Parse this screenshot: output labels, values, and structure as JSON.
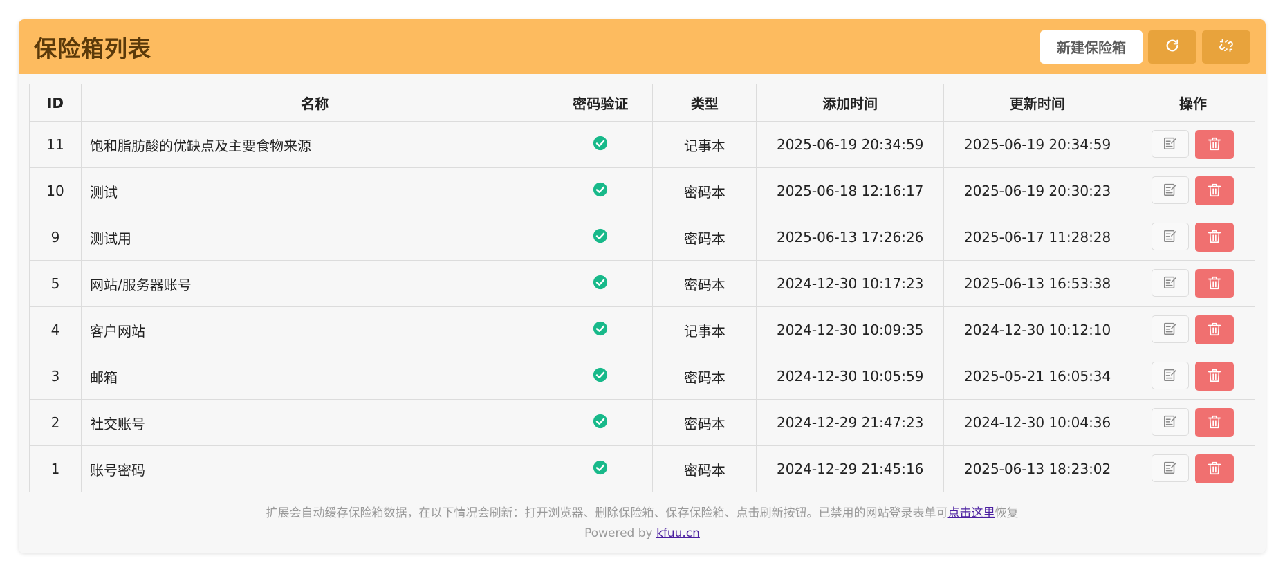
{
  "header": {
    "title": "保险箱列表",
    "new_button": "新建保险箱"
  },
  "table": {
    "columns": [
      "ID",
      "名称",
      "密码验证",
      "类型",
      "添加时间",
      "更新时间",
      "操作"
    ],
    "rows": [
      {
        "id": "11",
        "name": "饱和脂肪酸的优缺点及主要食物来源",
        "verified": true,
        "type": "记事本",
        "added": "2025-06-19 20:34:59",
        "updated": "2025-06-19 20:34:59"
      },
      {
        "id": "10",
        "name": "测试",
        "verified": true,
        "type": "密码本",
        "added": "2025-06-18 12:16:17",
        "updated": "2025-06-19 20:30:23"
      },
      {
        "id": "9",
        "name": "测试用",
        "verified": true,
        "type": "密码本",
        "added": "2025-06-13 17:26:26",
        "updated": "2025-06-17 11:28:28"
      },
      {
        "id": "5",
        "name": "网站/服务器账号",
        "verified": true,
        "type": "密码本",
        "added": "2024-12-30 10:17:23",
        "updated": "2025-06-13 16:53:38"
      },
      {
        "id": "4",
        "name": "客户网站",
        "verified": true,
        "type": "记事本",
        "added": "2024-12-30 10:09:35",
        "updated": "2024-12-30 10:12:10"
      },
      {
        "id": "3",
        "name": "邮箱",
        "verified": true,
        "type": "密码本",
        "added": "2024-12-30 10:05:59",
        "updated": "2025-05-21 16:05:34"
      },
      {
        "id": "2",
        "name": "社交账号",
        "verified": true,
        "type": "密码本",
        "added": "2024-12-29 21:47:23",
        "updated": "2024-12-30 10:04:36"
      },
      {
        "id": "1",
        "name": "账号密码",
        "verified": true,
        "type": "密码本",
        "added": "2024-12-29 21:45:16",
        "updated": "2025-06-13 18:23:02"
      }
    ]
  },
  "footer": {
    "note": "扩展会自动缓存保险箱数据，在以下情况会刷新：打开浏览器、删除保险箱、保存保险箱、点击刷新按钮。已禁用的网站登录表单可",
    "link": "点击这里",
    "note_after": "恢复",
    "powered_prefix": "Powered by ",
    "powered_link": "kfuu.cn"
  },
  "icons": {
    "refresh": "refresh-icon",
    "unlink": "unlink-icon",
    "check": "check-circle-icon",
    "edit": "edit-icon",
    "delete": "trash-icon"
  },
  "colors": {
    "header": "#fdbb5f",
    "header_button": "#e8a33c",
    "check": "#18b98a",
    "delete": "#f07070"
  }
}
